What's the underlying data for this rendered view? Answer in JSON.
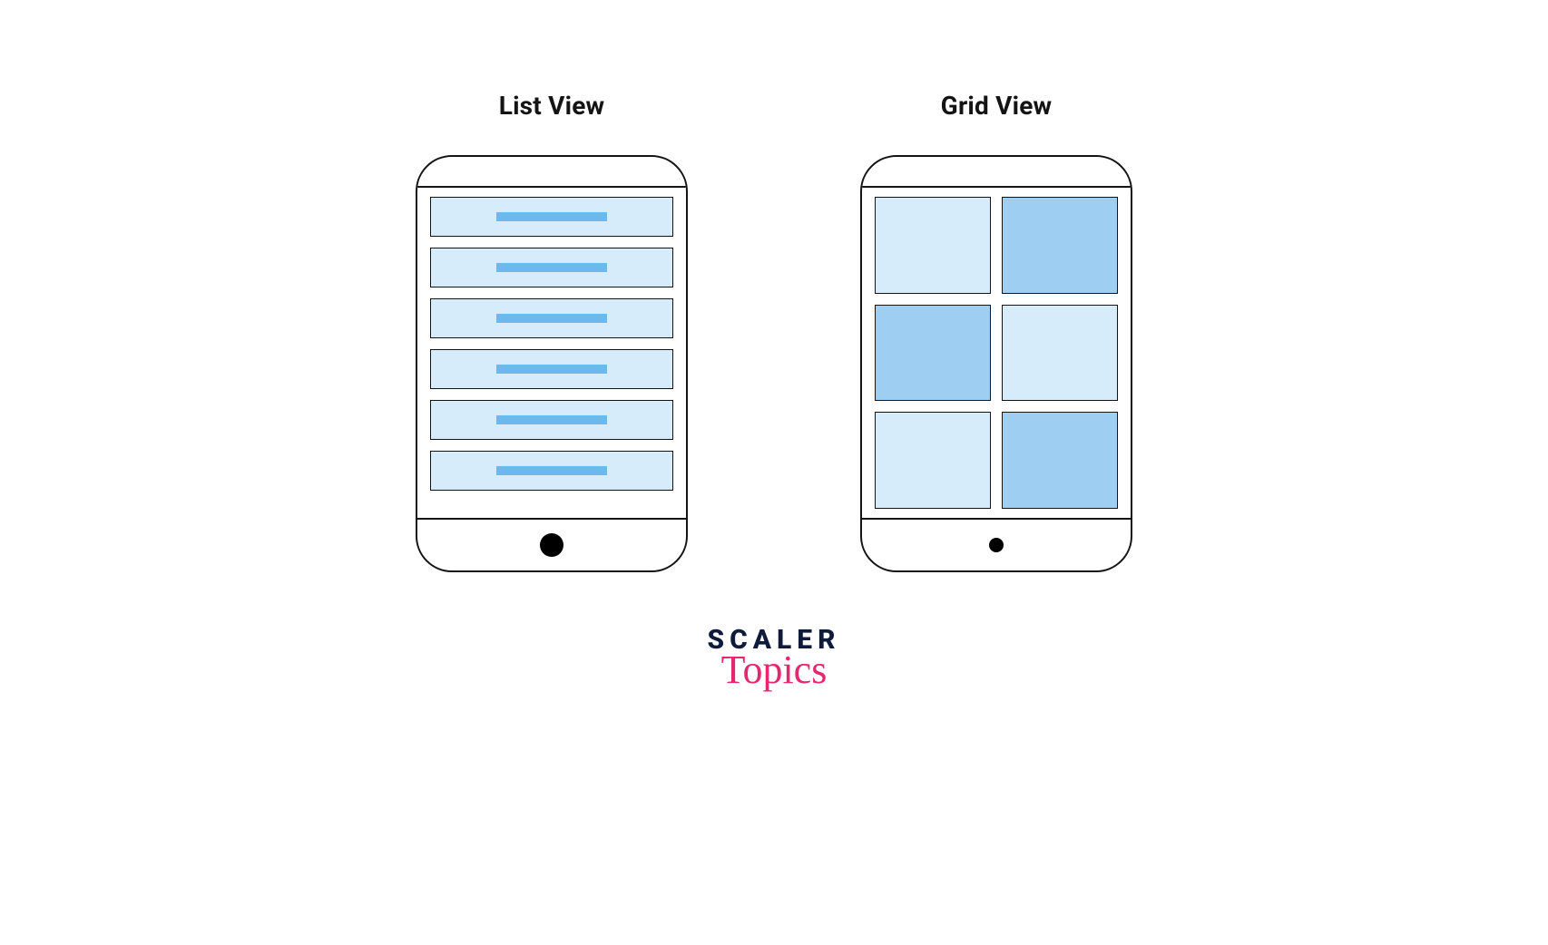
{
  "headings": {
    "list": "List View",
    "grid": "Grid View"
  },
  "colors": {
    "outline": "#141414",
    "row_bg": "#D7ECFB",
    "row_bar": "#6DB8EE",
    "tile_light": "#D7ECFB",
    "tile_dark": "#9ECFF3",
    "logo_word": "#0E1B3A",
    "logo_script": "#E6266E"
  },
  "list_rows": 6,
  "grid_tiles": [
    "light",
    "dark",
    "dark",
    "light",
    "light",
    "dark"
  ],
  "brand": {
    "line1": "SCALER",
    "line2": "Topics"
  }
}
